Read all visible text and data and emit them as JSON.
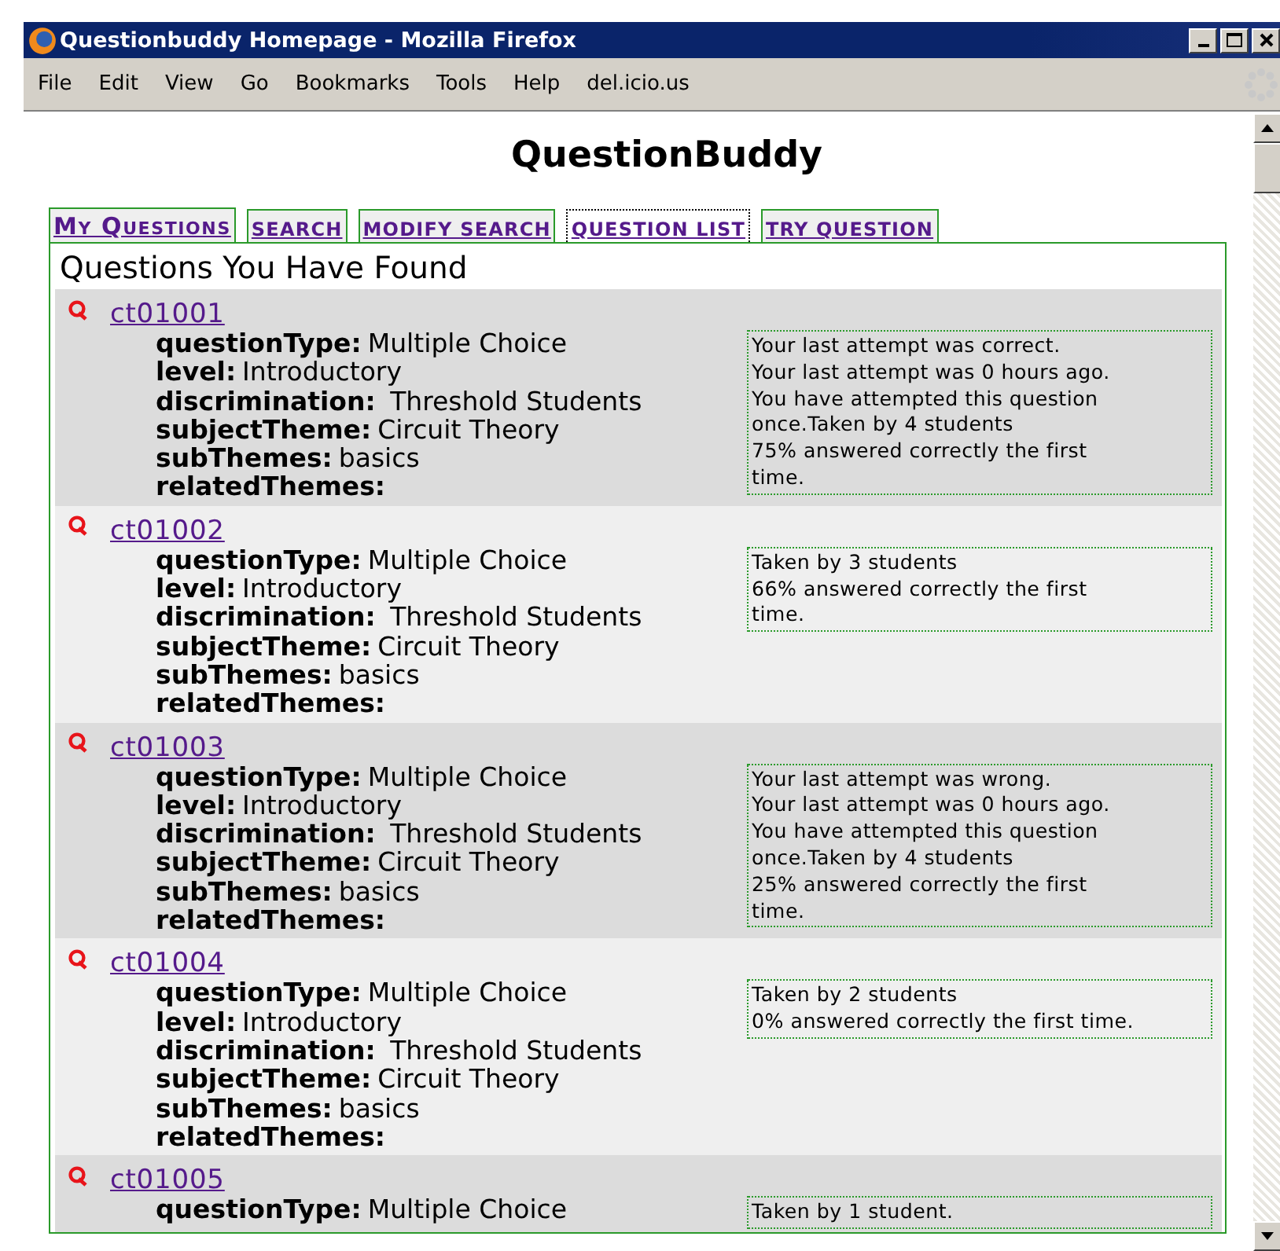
{
  "window": {
    "title": "Questionbuddy Homepage - Mozilla Firefox"
  },
  "menu": [
    "File",
    "Edit",
    "View",
    "Go",
    "Bookmarks",
    "Tools",
    "Help",
    "del.icio.us"
  ],
  "page_title": "QuestionBuddy",
  "tabs": [
    {
      "label": "My Questions",
      "selected": false
    },
    {
      "label": "SEARCH",
      "selected": false
    },
    {
      "label": "MODIFY SEARCH",
      "selected": false
    },
    {
      "label": "QUESTION LIST",
      "selected": true
    },
    {
      "label": "TRY QUESTION",
      "selected": false
    }
  ],
  "heading": "Questions You Have Found",
  "questions": [
    {
      "id": "ct01001",
      "fields": [
        {
          "label": "questionType:",
          "value": "Multiple Choice"
        },
        {
          "label": "level:",
          "value": "Introductory"
        },
        {
          "label": "discrimination:",
          "value": " Threshold Students"
        },
        {
          "label": "subjectTheme:",
          "value": "Circuit Theory"
        },
        {
          "label": "subThemes:",
          "value": "basics"
        },
        {
          "label": "relatedThemes:"
        }
      ],
      "stats": [
        "Your last attempt was correct.",
        "Your last attempt was 0 hours ago.",
        "You have attempted this question",
        "once.Taken by 4 students",
        "75% answered correctly the first",
        "time."
      ]
    },
    {
      "id": "ct01002",
      "fields": [
        {
          "label": "questionType:",
          "value": "Multiple Choice"
        },
        {
          "label": "level:",
          "value": "Introductory"
        },
        {
          "label": "discrimination:",
          "value": " Threshold Students"
        },
        {
          "label": "subjectTheme:",
          "value": "Circuit Theory"
        },
        {
          "label": "subThemes:",
          "value": "basics"
        },
        {
          "label": "relatedThemes:"
        }
      ],
      "stats": [
        "Taken by 3 students",
        "66% answered correctly the first",
        "time."
      ]
    },
    {
      "id": "ct01003",
      "fields": [
        {
          "label": "questionType:",
          "value": "Multiple Choice"
        },
        {
          "label": "level:",
          "value": "Introductory"
        },
        {
          "label": "discrimination:",
          "value": " Threshold Students"
        },
        {
          "label": "subjectTheme:",
          "value": "Circuit Theory"
        },
        {
          "label": "subThemes:",
          "value": "basics"
        },
        {
          "label": "relatedThemes:"
        }
      ],
      "stats": [
        "Your last attempt was wrong.",
        "Your last attempt was 0 hours ago.",
        "You have attempted this question",
        "once.Taken by 4 students",
        "25% answered correctly the first",
        "time."
      ]
    },
    {
      "id": "ct01004",
      "fields": [
        {
          "label": "questionType:",
          "value": "Multiple Choice"
        },
        {
          "label": "level:",
          "value": "Introductory"
        },
        {
          "label": "discrimination:",
          "value": " Threshold Students"
        },
        {
          "label": "subjectTheme:",
          "value": "Circuit Theory"
        },
        {
          "label": "subThemes:",
          "value": "basics"
        },
        {
          "label": "relatedThemes:"
        }
      ],
      "stats": [
        "Taken by 2 students",
        "0% answered correctly the first time."
      ]
    },
    {
      "id": "ct01005",
      "fields": [
        {
          "label": "questionType:",
          "value": "Multiple Choice"
        }
      ],
      "stats": [
        "Taken by 1 student."
      ]
    }
  ]
}
